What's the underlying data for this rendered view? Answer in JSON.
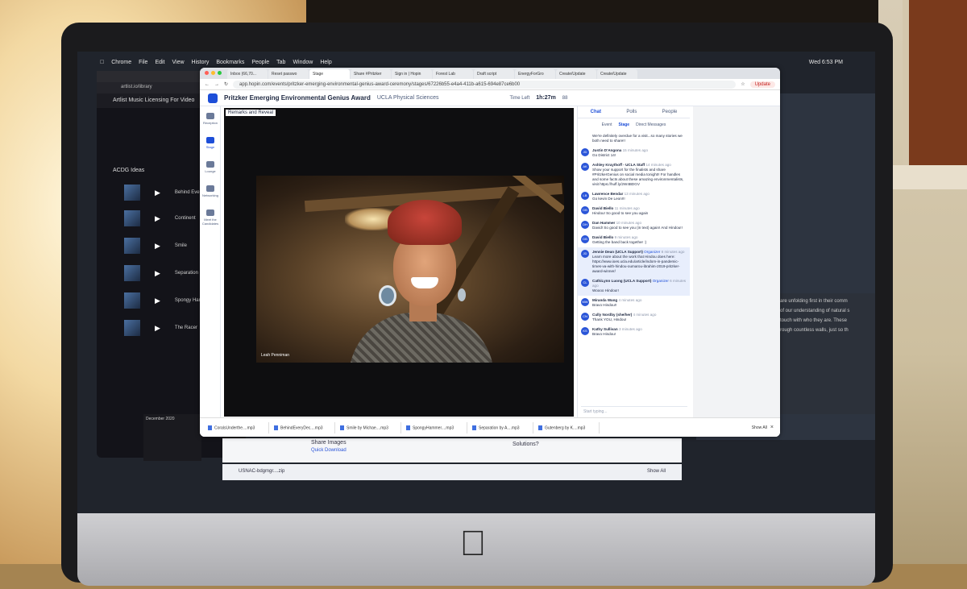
{
  "menubar": {
    "items": [
      "Chrome",
      "File",
      "Edit",
      "View",
      "History",
      "Bookmarks",
      "People",
      "Tab",
      "Window",
      "Help"
    ],
    "clock": "Wed 6:53 PM"
  },
  "bg_left": {
    "url": "artlist.io/library",
    "brand": "Artlist  Music Licensing For Video",
    "section": "ACDG Ideas",
    "tracks": [
      "Behind Every",
      "Continent",
      "Smile",
      "Separation",
      "Spongy Hamm",
      "The Racer"
    ],
    "calendar_month": "December 2020"
  },
  "chrome": {
    "tabs": [
      "Inbox (66,70...",
      "Reset passwo",
      "Stage",
      "Share #Pritzker",
      "Sign in | Hopin",
      "Forest Lab",
      "Draft script",
      "EnergyForGro",
      "Create/Update",
      "Create/Update"
    ],
    "active_tab_index": 2,
    "url": "app.hopin.com/events/pritzker-emerging-environmental-genius-award-ceremony/stages/67226b55-e4a4-411b-a615-694e87ce6b00",
    "update_label": "Update"
  },
  "hopin": {
    "event_name": "Pritzker Emerging Environmental Genius Award",
    "org": "UCLA Physical Sciences",
    "time_left_label": "Time Left",
    "timer": "1h:27m",
    "attendees": "88",
    "nav": [
      {
        "label": "Reception",
        "active": false
      },
      {
        "label": "Stage",
        "active": true
      },
      {
        "label": "Lounge",
        "active": false
      },
      {
        "label": "Networking",
        "active": false
      },
      {
        "label": "Meet the Candidates",
        "active": false
      }
    ],
    "stage_title": "Remarks and Reveal",
    "speaker_name": "Leah Penniman"
  },
  "chat": {
    "tabs": [
      "Chat",
      "Polls",
      "People"
    ],
    "sub_tabs": [
      "Event",
      "Stage",
      "Direct Messages"
    ],
    "messages": [
      {
        "initials": "",
        "name": "",
        "time": "",
        "text": "We're definitely overdue for a visit...so many stories we both need to share!!",
        "org": "",
        "hl": false
      },
      {
        "initials": "JD",
        "name": "Justin D'Angona",
        "time": "15 minutes ago",
        "text": "Go District 14!",
        "org": "",
        "hl": false
      },
      {
        "initials": "AK",
        "name": "Ashley Kruythoff - UCLA Staff",
        "time": "14 minutes ago",
        "text": "Show your support for the finalists and share #PritzkerGenius on social media tonight!! For handles and some facts about these amazing environmentalists, visit https://huff.ly/2W4BDGV",
        "org": "",
        "hl": false
      },
      {
        "initials": "LB",
        "name": "Lawrence Bendar",
        "time": "13 minutes ago",
        "text": "Go kevin De Leon!!!",
        "org": "",
        "hl": false
      },
      {
        "initials": "DB",
        "name": "David Biello",
        "time": "11 minutes ago",
        "text": "Hindou! So good to see you again",
        "org": "",
        "hl": false
      },
      {
        "initials": "DH",
        "name": "Dan Hammer",
        "time": "10 minutes ago",
        "text": "David! So good to see you (in text) again! And Hindou!!",
        "org": "",
        "hl": false
      },
      {
        "initials": "DB",
        "name": "David Biello",
        "time": "9 minutes ago",
        "text": "Getting the band back together :)",
        "org": "",
        "hl": false
      },
      {
        "initials": "JD",
        "name": "Jennie Dean (UCLA Support)",
        "time": "8 minutes ago",
        "text": "Learn more about the work that Hindou does here: https://www.ioes.ucla.edu/article/indom-in-pandemic-times-va-with-hindou-oumarou-ibrahim-2019-pritzker-award-winner/",
        "org": "Organizer",
        "hl": true
      },
      {
        "initials": "CL",
        "name": "CathiLynn Luong (UCLA Support)",
        "time": "6 minutes ago",
        "text": "Woooo Hindou!!",
        "org": "Organizer",
        "hl": true
      },
      {
        "initials": "MW",
        "name": "Miranda Wang",
        "time": "4 minutes ago",
        "text": "Bravo Hindou!!",
        "org": "",
        "hl": false
      },
      {
        "initials": "CN",
        "name": "Cully Nordby (she/her)",
        "time": "4 minutes ago",
        "text": "Thank YOU, Hindou!",
        "org": "",
        "hl": false
      },
      {
        "initials": "KS",
        "name": "Kathy Sullivan",
        "time": "3 minutes ago",
        "text": "Bravo Hindou!",
        "org": "",
        "hl": false
      }
    ],
    "input_placeholder": "Start typing..."
  },
  "downloads": {
    "items": [
      "CoralsUnderthe....mp3",
      "BehindEveryDec....mp3",
      "Smile by Michae....mp3",
      "SpongyHammer....mp3",
      "Separation by A....mp3",
      "Gutenberg by K....mp3"
    ],
    "show_all": "Show All",
    "close": "×"
  },
  "bg_bottom": {
    "line1": "Share Images",
    "line2": "Quick Download",
    "line3": "Solutions?",
    "zip": "USNAC-bdgmgr....zip",
    "show_all": "Show All"
  },
  "bg_right": {
    "para1": "are unfolding first in their comm",
    "para2": "of our understanding of natural s",
    "para3": "touch with who they are. These",
    "para4": "rough countless walls, just so th"
  }
}
